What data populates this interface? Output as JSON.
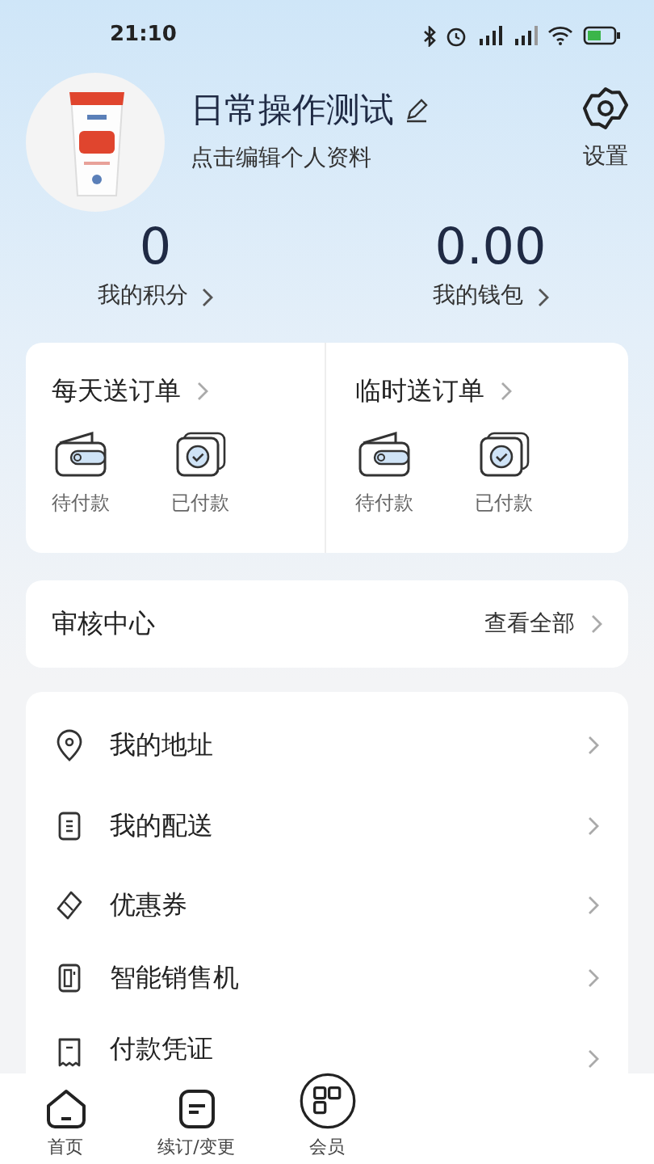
{
  "status_bar": {
    "time": "21:10"
  },
  "profile": {
    "name": "日常操作测试",
    "subtitle": "点击编辑个人资料",
    "settings_label": "设置"
  },
  "stats": [
    {
      "value": "0",
      "label": "我的积分"
    },
    {
      "value": "0.00",
      "label": "我的钱包"
    }
  ],
  "order_groups": [
    {
      "title": "每天送订单",
      "items": [
        {
          "kind": "unpaid",
          "label": "待付款"
        },
        {
          "kind": "paid",
          "label": "已付款"
        }
      ]
    },
    {
      "title": "临时送订单",
      "items": [
        {
          "kind": "unpaid",
          "label": "待付款"
        },
        {
          "kind": "paid",
          "label": "已付款"
        }
      ]
    }
  ],
  "review": {
    "title": "审核中心",
    "link": "查看全部"
  },
  "menu": [
    {
      "kind": "location",
      "label": "我的地址"
    },
    {
      "kind": "document",
      "label": "我的配送"
    },
    {
      "kind": "coupon",
      "label": "优惠券"
    },
    {
      "kind": "machine",
      "label": "智能销售机"
    },
    {
      "kind": "receipt",
      "label": "付款凭证"
    }
  ],
  "bottom_nav": [
    {
      "kind": "home",
      "label": "首页",
      "selected": false
    },
    {
      "kind": "renew",
      "label": "续订/变更",
      "selected": false
    },
    {
      "kind": "code",
      "label": "会员",
      "selected": false
    }
  ]
}
